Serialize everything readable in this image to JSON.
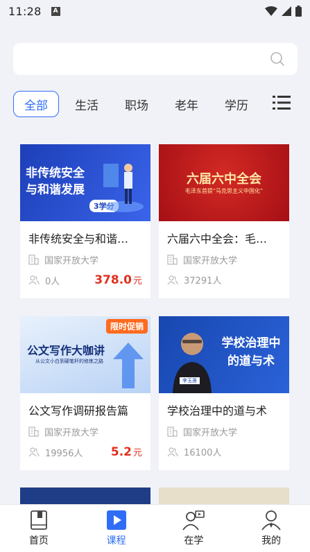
{
  "status": {
    "time": "11:28",
    "badge": "A"
  },
  "search": {
    "placeholder": ""
  },
  "tabs": [
    {
      "label": "全部",
      "active": true
    },
    {
      "label": "生活"
    },
    {
      "label": "职场"
    },
    {
      "label": "老年"
    },
    {
      "label": "学历"
    }
  ],
  "courses": [
    {
      "title": "非传统安全与和谐…",
      "org": "国家开放大学",
      "learners": "0人",
      "price": "378.0",
      "unit": "元",
      "thumb_text": "非传统安全与和谐发展",
      "thumb_badge": "3学分",
      "thumb_colors": [
        "#1d3fb8",
        "#3a64ea"
      ]
    },
    {
      "title": "六届六中全会：毛…",
      "org": "国家开放大学",
      "learners": "37291人",
      "price": "",
      "unit": "",
      "thumb_text": "六届六中全会",
      "thumb_sub": "毛泽东首提“马克思主义中国化”",
      "thumb_colors": [
        "#b7141b",
        "#d42a24"
      ]
    },
    {
      "title": "公文写作调研报告篇",
      "org": "国家开放大学",
      "learners": "19956人",
      "price": "5.2",
      "unit": "元",
      "thumb_text": "公文写作大咖讲",
      "thumb_badge": "限时促销",
      "thumb_sub": "从公文小白到硬笔杆的修炼之路",
      "thumb_colors": [
        "#dbe8fb",
        "#b9d2f5"
      ]
    },
    {
      "title": "学校治理中的道与术",
      "org": "国家开放大学",
      "learners": "16100人",
      "price": "",
      "unit": "",
      "thumb_text": "学校治理中的道与术",
      "thumb_sub": "李玉莲",
      "thumb_colors": [
        "#1747b0",
        "#2b62d8"
      ]
    }
  ],
  "nav": [
    {
      "label": "首页",
      "icon": "book-icon"
    },
    {
      "label": "课程",
      "icon": "play-icon",
      "active": true
    },
    {
      "label": "在学",
      "icon": "learning-icon"
    },
    {
      "label": "我的",
      "icon": "profile-icon"
    }
  ],
  "colors": {
    "accent": "#2f6df6",
    "price": "#e0301e",
    "background": "#f1f2f7"
  }
}
